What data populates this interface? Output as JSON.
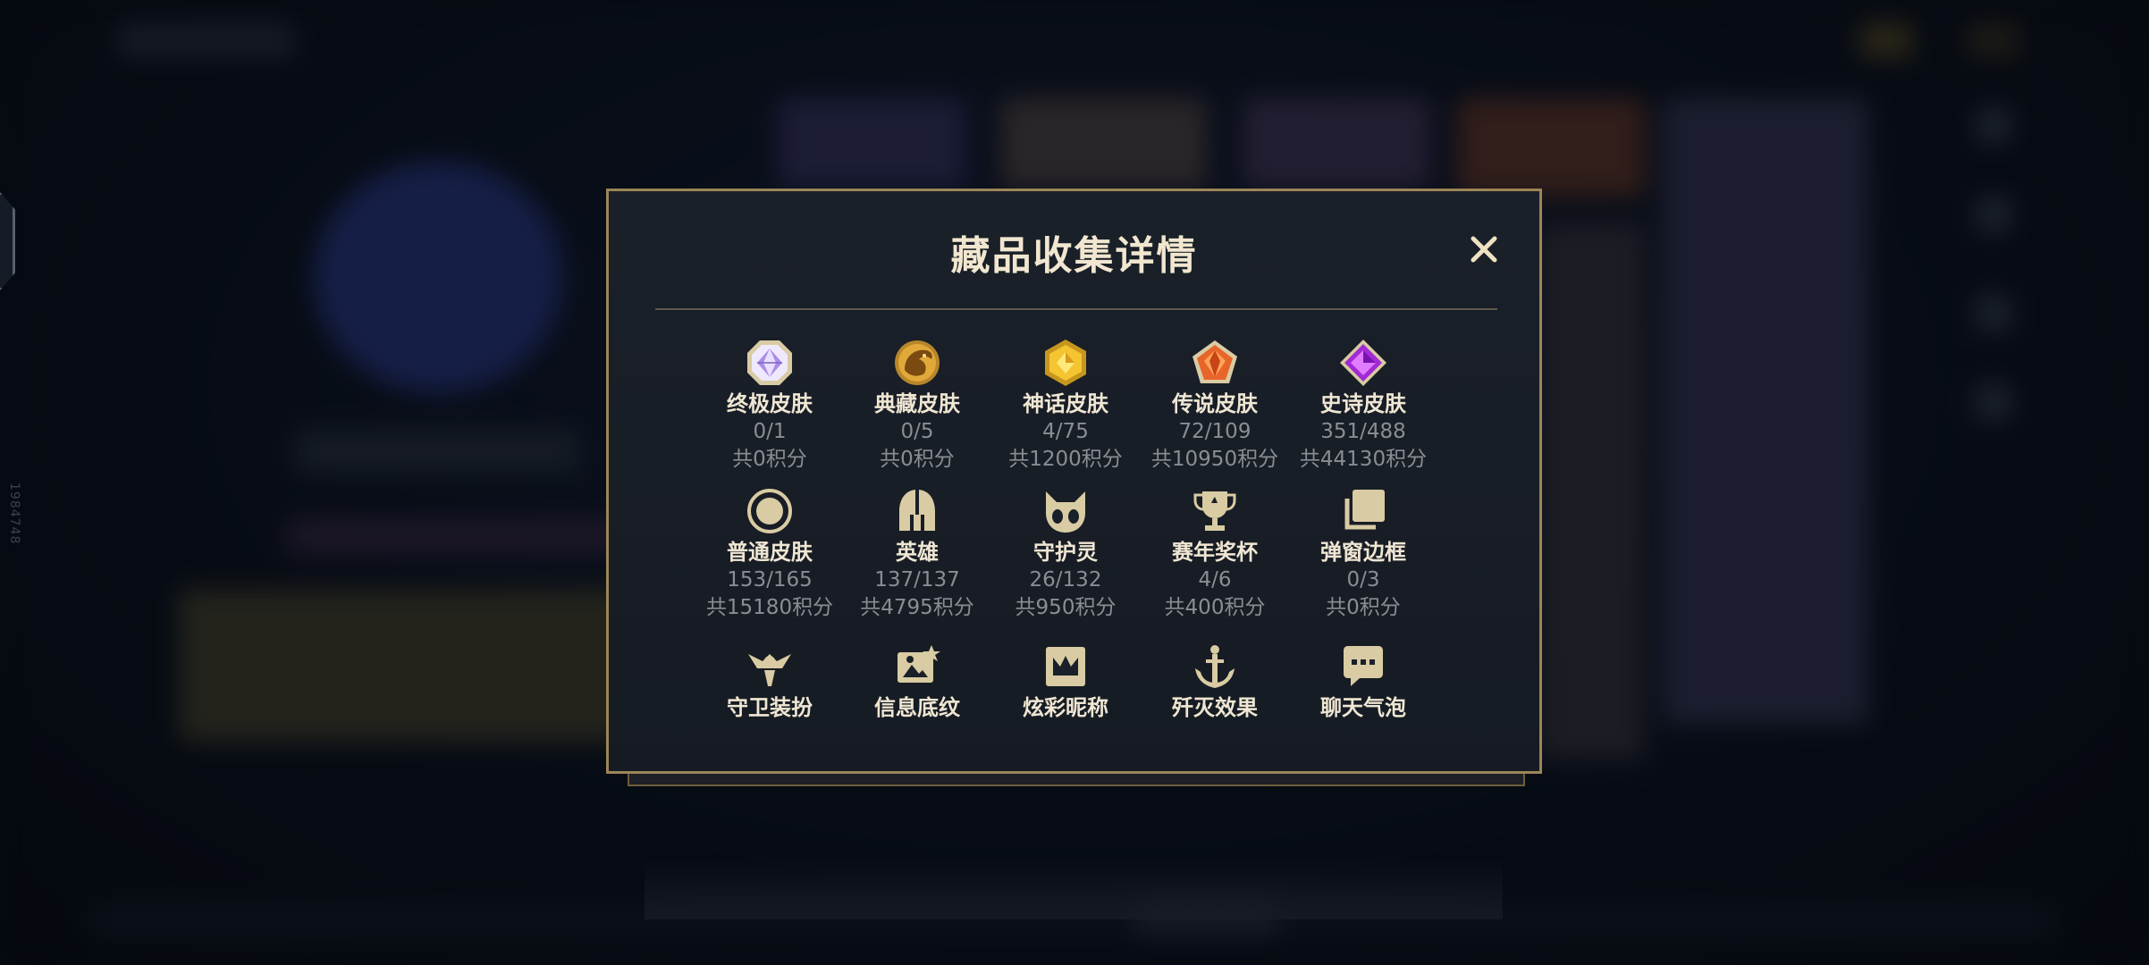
{
  "modal": {
    "title": "藏品收集详情",
    "close_label": "✕"
  },
  "side": {
    "vertical_text": "1984748"
  },
  "collection_items": [
    {
      "label": "终极皮肤",
      "count": "0/1",
      "points": "共0积分",
      "icon": "diamond-octagon-icon"
    },
    {
      "label": "典藏皮肤",
      "count": "0/5",
      "points": "共0积分",
      "icon": "dragon-badge-icon"
    },
    {
      "label": "神话皮肤",
      "count": "4/75",
      "points": "共1200积分",
      "icon": "gold-hexagon-gem-icon"
    },
    {
      "label": "传说皮肤",
      "count": "72/109",
      "points": "共10950积分",
      "icon": "orange-pentagon-gem-icon"
    },
    {
      "label": "史诗皮肤",
      "count": "351/488",
      "points": "共44130积分",
      "icon": "purple-diamond-gem-icon"
    },
    {
      "label": "普通皮肤",
      "count": "153/165",
      "points": "共15180积分",
      "icon": "ring-icon"
    },
    {
      "label": "英雄",
      "count": "137/137",
      "points": "共4795积分",
      "icon": "helmet-icon"
    },
    {
      "label": "守护灵",
      "count": "26/132",
      "points": "共950积分",
      "icon": "spirit-cat-icon"
    },
    {
      "label": "赛年奖杯",
      "count": "4/6",
      "points": "共400积分",
      "icon": "trophy-icon"
    },
    {
      "label": "弹窗边框",
      "count": "0/3",
      "points": "共0积分",
      "icon": "stacked-frames-icon"
    },
    {
      "label": "守卫装扮",
      "icon": "ward-icon"
    },
    {
      "label": "信息底纹",
      "icon": "image-card-icon"
    },
    {
      "label": "炫彩昵称",
      "icon": "crown-frame-icon"
    },
    {
      "label": "歼灭效果",
      "icon": "anchor-icon"
    },
    {
      "label": "聊天气泡",
      "icon": "chat-bubble-icon"
    }
  ],
  "colors": {
    "accent_gold": "#9c8556",
    "title_text": "#f1e6cf",
    "secondary_text": "#8a8d93",
    "panel_bg": "#1a2029"
  }
}
